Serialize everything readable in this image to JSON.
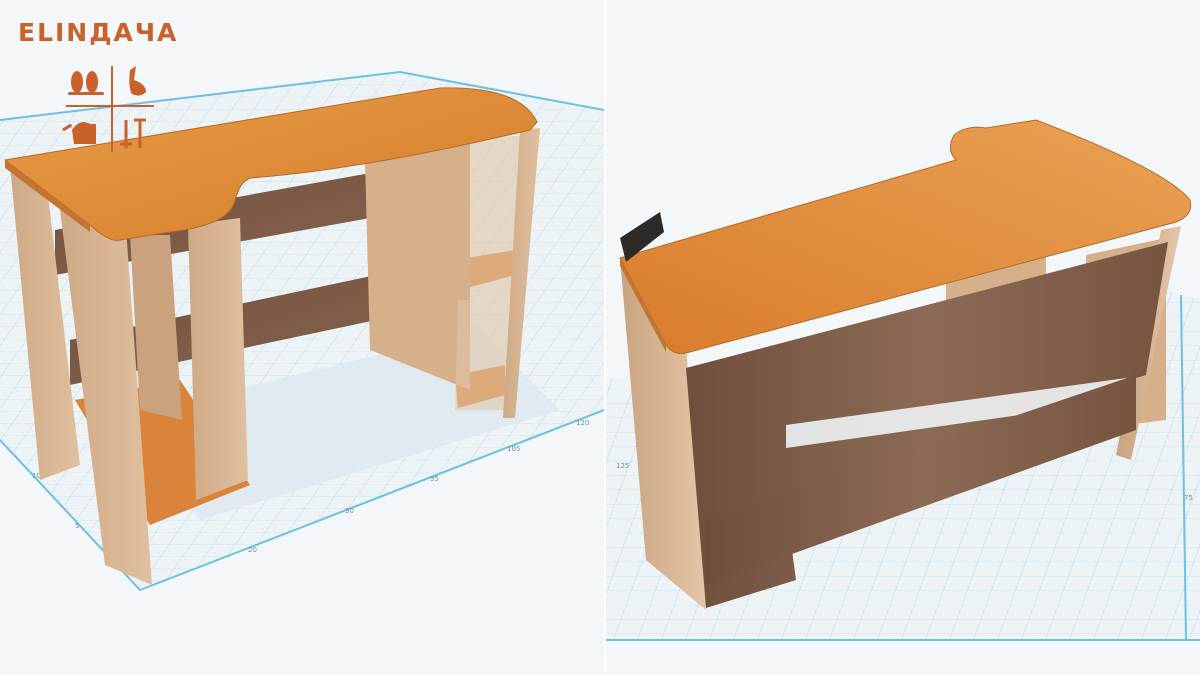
{
  "brand": {
    "name": "ELINДАЧА",
    "color": "#c8612a",
    "logo_icons": [
      "flip-flops-icon",
      "rabbit-icon",
      "watering-can-icon",
      "shovel-rake-icon"
    ]
  },
  "views": [
    {
      "id": "front-3d-view",
      "subject": "computer-desk-3d-model",
      "ruler_ticks": [
        "5",
        "10",
        "15",
        "20",
        "25",
        "30",
        "35",
        "105",
        "120"
      ]
    },
    {
      "id": "back-3d-view",
      "subject": "computer-desk-3d-model",
      "ruler_ticks": [
        "125",
        "75"
      ]
    }
  ],
  "colors": {
    "grid_background": "#eef3f6",
    "grid_line": "#b7dbee",
    "grid_major": "#6cc0e6",
    "desktop_top": "#e08a35",
    "panel_beige": "#d8b48e",
    "panel_dark": "#7b5a46",
    "shelf_orange": "#d9843a"
  }
}
